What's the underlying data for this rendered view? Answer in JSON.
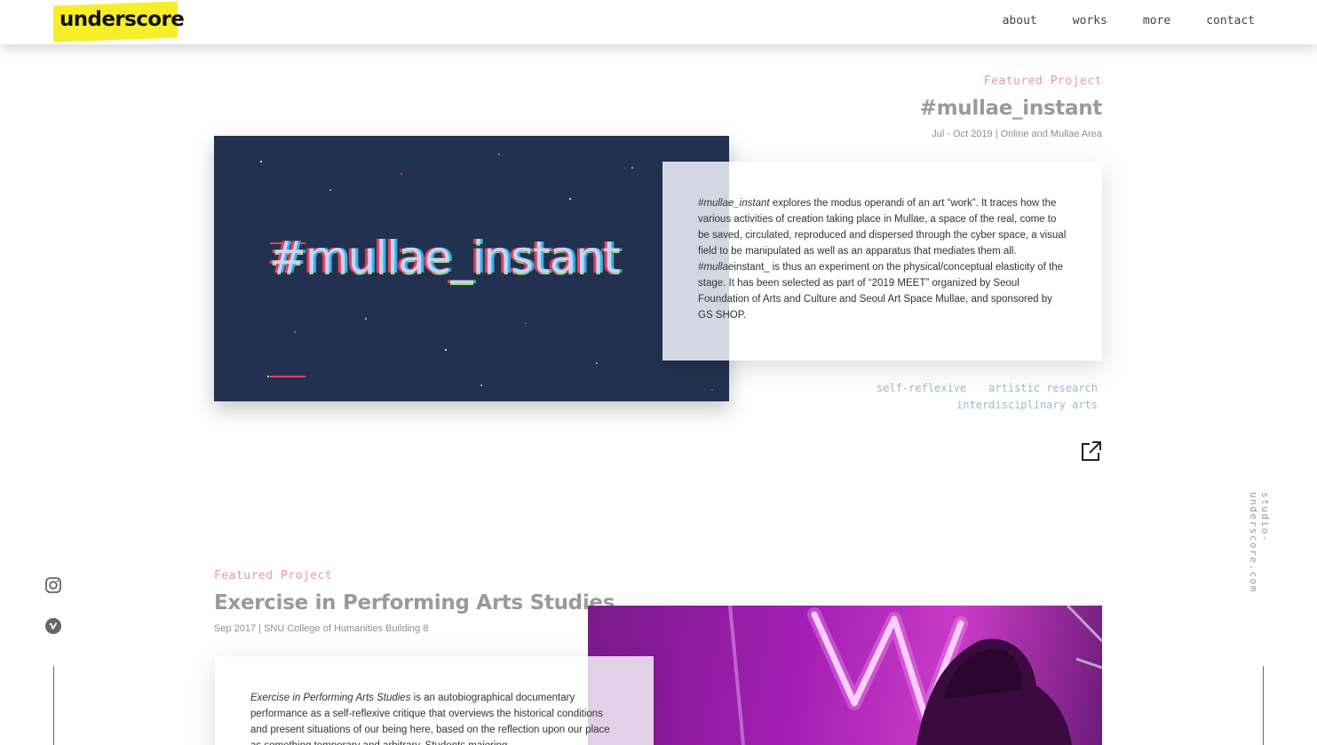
{
  "header": {
    "logo": "underscore",
    "nav": [
      "about",
      "works",
      "more",
      "contact"
    ]
  },
  "projects": [
    {
      "featured_label": "Featured Project",
      "title": "#mullae_instant",
      "date_location": "Jul - Oct 2019 | Online and Mullae Area",
      "image_text": "#mullae_instant",
      "description": {
        "em1": "#mullae_instant",
        "t1": " explores the modus operandi of an art “work”. It traces how the various activities of creation taking place in Mullae, a space of the real, come to be saved, circulated, reproduced and dispersed through the cyber space, a visual field to be manipulated as well as an apparatus that mediates them all. ",
        "em2": "#mullae",
        "t2": "instant_ is thus an experiment on the physical/conceptual elasticity of the stage. It has been selected as part of “2019 MEET” organized by Seoul Foundation of Arts and Culture and Seoul Art Space Mullae, and sponsored by GS SHOP."
      },
      "tags": [
        "self-reflexive",
        "artistic research",
        "interdisciplinary arts"
      ],
      "link_icon": "external-link-icon"
    },
    {
      "featured_label": "Featured Project",
      "title": "Exercise in Performing Arts Studies",
      "date_location": "Sep 2017 | SNU College of Humanities Building 8",
      "description": {
        "em1": "Exercise in Performing Arts Studies",
        "t1": " is an autobiographical documentary performance as a self-reflexive critique that overviews the historical conditions and present situations of our being here, based on the reflection upon our place as something temporary and arbitrary. Students majoring"
      }
    }
  ],
  "social": [
    "instagram-icon",
    "vimeo-icon"
  ],
  "side_text": "studio-underscore.com",
  "colors": {
    "logo_bg": "#f7ee2a",
    "featured": "#e79aa3",
    "tag": "#a7b3d0",
    "image1_bg": "#233150",
    "image2_bg": "#a11eb3",
    "line": "#5967a8"
  }
}
